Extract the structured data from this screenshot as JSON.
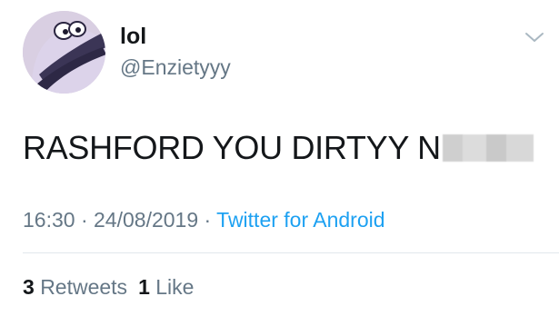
{
  "author": {
    "display_name": "lol",
    "handle": "@Enzietyyy",
    "avatar_icon": "cartoon-bird-avatar-icon"
  },
  "menu": {
    "icon": "chevron-down-icon"
  },
  "tweet": {
    "text": "RASHFORD YOU DIRTYY N",
    "redacted": true
  },
  "meta": {
    "time": "16:30",
    "separator1": " · ",
    "date": "24/08/2019",
    "separator2": " · ",
    "source": "Twitter for Android"
  },
  "stats": {
    "retweets_count": "3",
    "retweets_label": "Retweets",
    "likes_count": "1",
    "likes_label": "Like"
  },
  "colors": {
    "text": "#14171a",
    "secondary": "#657786",
    "link": "#1da1f2",
    "divider": "#e1e8ed"
  }
}
